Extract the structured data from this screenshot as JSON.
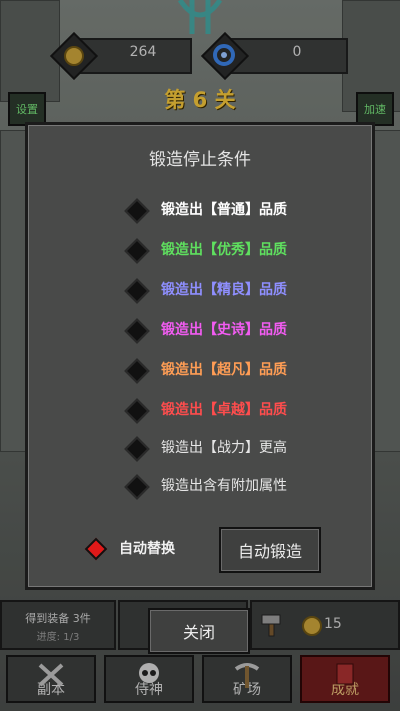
{
  "header": {
    "gold_value": "264",
    "gem_value": "0",
    "level_label": "第 6 关",
    "settings_label": "设置",
    "speedup_label": "加速"
  },
  "dialog": {
    "title": "锻造停止条件",
    "options": [
      {
        "label": "锻造出【普通】品质",
        "color": "#ffffff"
      },
      {
        "label": "锻造出【优秀】品质",
        "color": "#5fe05f"
      },
      {
        "label": "锻造出【精良】品质",
        "color": "#8f8fff"
      },
      {
        "label": "锻造出【史诗】品质",
        "color": "#f25cf2"
      },
      {
        "label": "锻造出【超凡】品质",
        "color": "#ff9d55"
      },
      {
        "label": "锻造出【卓越】品质",
        "color": "#ff4d4d"
      },
      {
        "label": "锻造出【战力】更高",
        "color": "#e6e6e6"
      },
      {
        "label": "锻造出含有附加属性",
        "color": "#e6e6e6"
      }
    ],
    "auto_replace_label": "自动替换",
    "auto_forge_label": "自动锻造",
    "close_label": "关闭"
  },
  "bottom": {
    "equipment_text": "得到装备 3件",
    "progress_text": "进度: 1/3",
    "coin_value": "15"
  },
  "tabs": [
    {
      "label": "副本",
      "icon": "crossed-swords-icon"
    },
    {
      "label": "侍神",
      "icon": "skull-icon"
    },
    {
      "label": "矿场",
      "icon": "pickaxe-icon"
    },
    {
      "label": "成就",
      "icon": "banner-icon"
    }
  ],
  "colors": {
    "level": "#f0c23a",
    "auto_replace_selected": "#e01919"
  }
}
